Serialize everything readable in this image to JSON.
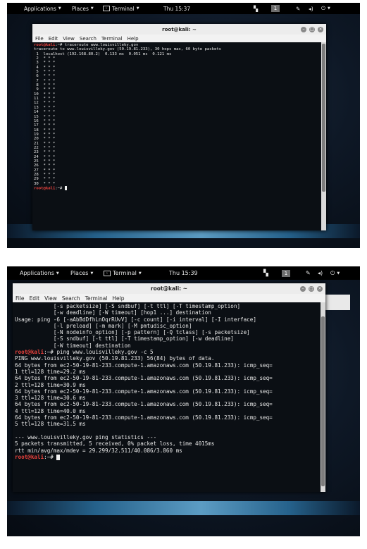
{
  "screen1": {
    "topbar": {
      "applications": "Applications",
      "places": "Places",
      "terminal": "Terminal",
      "clock": "Thu 15:37",
      "workspace": "1"
    },
    "window": {
      "title": "root@kali: ~",
      "menu": [
        "File",
        "Edit",
        "View",
        "Search",
        "Terminal",
        "Help"
      ],
      "prompt": "root@kali",
      "prompt_suffix": ":~# ",
      "command": "traceroute www.louisvilleky.gov",
      "output": [
        "traceroute to www.louisvilleky.gov (50.19.81.233), 30 hops max, 60 byte packets",
        " 1  localhost (192.168.80.2)  0.133 ms  0.051 ms  0.121 ms",
        " 2  * * *",
        " 3  * * *",
        " 4  * * *",
        " 5  * * *",
        " 6  * * *",
        " 7  * * *",
        " 8  * * *",
        " 9  * * *",
        "10  * * *",
        "11  * * *",
        "12  * * *",
        "13  * * *",
        "14  * * *",
        "15  * * *",
        "16  * * *",
        "17  * * *",
        "18  * * *",
        "19  * * *",
        "20  * * *",
        "21  * * *",
        "22  * * *",
        "23  * * *",
        "24  * * *",
        "25  * * *",
        "26  * * *",
        "27  * * *",
        "28  * * *",
        "29  * * *",
        "30  * * *"
      ]
    }
  },
  "screen2": {
    "topbar": {
      "applications": "Applications",
      "places": "Places",
      "terminal": "Terminal",
      "clock": "Thu 15:39",
      "workspace": "1"
    },
    "window": {
      "title": "root@kali: ~",
      "menu": [
        "File",
        "Edit",
        "View",
        "Search",
        "Terminal",
        "Help"
      ],
      "prompt": "root@kali",
      "prompt_suffix": ":~# ",
      "pre_output": [
        "            [-s packetsize] [-S sndbuf] [-t ttl] [-T timestamp_option]",
        "            [-w deadline] [-W timeout] [hop1 ...] destination",
        "Usage: ping -6 [-aAbBdDfhLnOqrRUvV] [-c count] [-i interval] [-I interface]",
        "            [-l preload] [-m mark] [-M pmtudisc_option]",
        "            [-N nodeinfo_option] [-p pattern] [-Q tclass] [-s packetsize]",
        "            [-S sndbuf] [-t ttl] [-T timestamp_option] [-w deadline]",
        "            [-W timeout] destination"
      ],
      "command": "ping www.louisvilleky.gov -c 5",
      "output": [
        "PING www.louisvilleky.gov (50.19.81.233) 56(84) bytes of data.",
        "64 bytes from ec2-50-19-81-233.compute-1.amazonaws.com (50.19.81.233): icmp_seq=",
        "1 ttl=128 time=29.2 ms",
        "64 bytes from ec2-50-19-81-233.compute-1.amazonaws.com (50.19.81.233): icmp_seq=",
        "2 ttl=128 time=30.9 ms",
        "64 bytes from ec2-50-19-81-233.compute-1.amazonaws.com (50.19.81.233): icmp_seq=",
        "3 ttl=128 time=30.6 ms",
        "64 bytes from ec2-50-19-81-233.compute-1.amazonaws.com (50.19.81.233): icmp_seq=",
        "4 ttl=128 time=40.0 ms",
        "64 bytes from ec2-50-19-81-233.compute-1.amazonaws.com (50.19.81.233): icmp_seq=",
        "5 ttl=128 time=31.5 ms",
        "",
        "--- www.louisvilleky.gov ping statistics ---",
        "5 packets transmitted, 5 received, 0% packet loss, time 4015ms",
        "rtt min/avg/max/mdev = 29.299/32.511/40.086/3.860 ms"
      ]
    }
  },
  "colors": {
    "prompt": "#e8413c",
    "terminal_bg": "#0b0f14",
    "glow": "#6ab4e0"
  }
}
